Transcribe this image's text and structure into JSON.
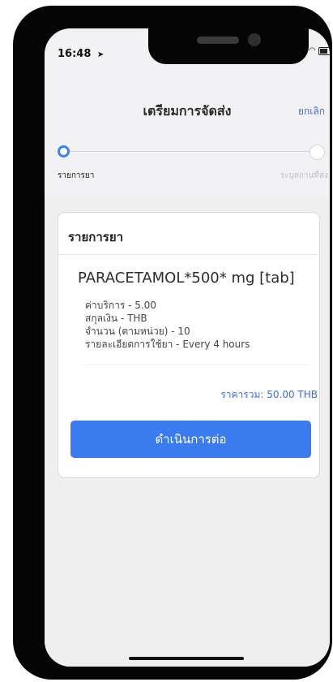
{
  "status_bar": {
    "time": "16:48",
    "location_icon": "location-arrow-icon",
    "signal_icon": "signal-bars-icon",
    "wifi_icon": "wifi-icon",
    "battery_icon": "battery-icon"
  },
  "nav": {
    "title": "เตรียมการจัดส่ง",
    "cancel_label": "ยกเลิก"
  },
  "stepper": {
    "steps": [
      {
        "label": "รายการยา",
        "state": "active"
      },
      {
        "label": "ระบุสถานที่ส่ง",
        "state": "inactive"
      }
    ]
  },
  "card": {
    "header": "รายการยา",
    "drug": {
      "name": "PARACETAMOL*500* mg [tab]",
      "details": [
        "ค่าบริการ - 5.00",
        "สกุลเงิน - THB",
        "จำนวน (ตามหน่วย) - 10",
        "รายละเอียดการใช้ยา - Every 4 hours"
      ]
    },
    "total": "ราคารวม: 50.00 THB",
    "continue_label": "ดำเนินการต่อ"
  },
  "colors": {
    "accent": "#3a7cf0",
    "link": "#3b6fe0",
    "stepper_active": "#3a82f7",
    "background": "#efefef"
  }
}
